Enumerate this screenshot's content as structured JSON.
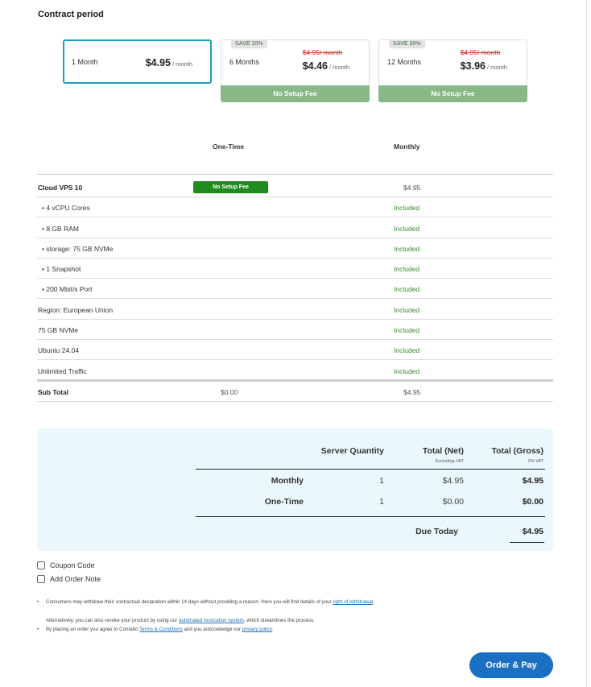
{
  "contract": {
    "title": "Contract period",
    "options": [
      {
        "label": "1 Month",
        "price": "$4.95",
        "per": "/ month",
        "selected": true
      },
      {
        "label": "6 Months",
        "price": "$4.46",
        "per": "/ month",
        "old_price": "$4.95/ month",
        "badge": "SAVE 10%",
        "fee_note": "No Setup Fee"
      },
      {
        "label": "12 Months",
        "price": "$3.96",
        "per": "/ month",
        "old_price": "$4.95/ month",
        "badge": "SAVE 20%",
        "fee_note": "No Setup Fee"
      }
    ]
  },
  "table": {
    "col_one_time": "One-Time",
    "col_monthly": "Monthly",
    "product": {
      "name": "Cloud VPS 10",
      "fee_badge": "No Setup Fee",
      "monthly": "$4.95"
    },
    "rows": [
      {
        "name": "• 4 vCPU Cores",
        "monthly": "Included"
      },
      {
        "name": "• 8 GB RAM",
        "monthly": "Included"
      },
      {
        "name": "• storage: 75 GB NVMe",
        "monthly": "Included"
      },
      {
        "name": "• 1 Snapshot",
        "monthly": "Included"
      },
      {
        "name": "• 200 Mbit/s Port",
        "monthly": "Included"
      },
      {
        "name": "Region: European Union",
        "monthly": "Included"
      },
      {
        "name": "75 GB NVMe",
        "monthly": "Included"
      },
      {
        "name": "Ubuntu 24.04",
        "monthly": "Included"
      },
      {
        "name": "Unlimited Traffic",
        "monthly": "Included"
      }
    ],
    "subtotal": {
      "name": "Sub Total",
      "one_time": "$0.00",
      "monthly": "$4.95"
    }
  },
  "summary": {
    "col_quantity": "Server Quantity",
    "col_net": "Total (Net)",
    "col_net_sub": "Excluding VAT",
    "col_gross": "Total (Gross)",
    "col_gross_sub": "0% VAT",
    "monthly": {
      "label": "Monthly",
      "qty": "1",
      "net": "$4.95",
      "gross": "$4.95"
    },
    "one_time": {
      "label": "One-Time",
      "qty": "1",
      "net": "$0.00",
      "gross": "$0.00"
    },
    "due_label": "Due Today",
    "due_value": "$4.95"
  },
  "options": {
    "coupon": "Coupon Code",
    "note": "Add Order Note"
  },
  "legal": {
    "p1_text": "Consumers may withdraw their contractual declaration within 14 days without providing a reason. Here you will find details of your",
    "p1_link": "right of withdrawal",
    "p1_end": ".",
    "p2_text": "Alternatively, you can also revoke your product by using our",
    "p2_link": "automated revocation system",
    "p2_end": ", which streamlines the process.",
    "p3_text": "By placing an order you agree to Contabo",
    "p3_link1": "Terms & Conditions",
    "p3_mid": "and you acknowledge our",
    "p3_link2": "privacy policy",
    "p3_end": "."
  },
  "order_button": "Order & Pay"
}
